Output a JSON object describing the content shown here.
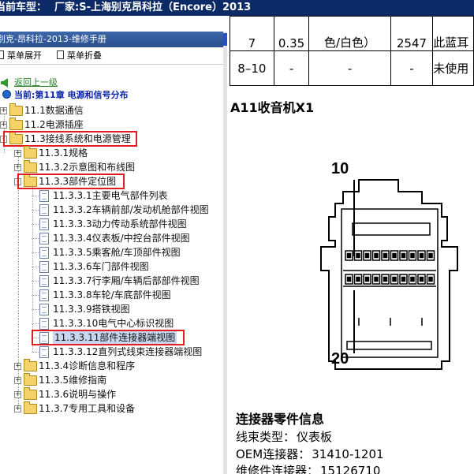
{
  "window": {
    "title_label": "当前车型：",
    "title_value": "厂家:S-上海别克昂科拉（Encore）2013"
  },
  "left_panel": {
    "title": "别克-昂科拉-2013-维修手册",
    "menu": {
      "expand": "菜单展开",
      "collapse": "菜单折叠"
    },
    "back_link": "返回上一级",
    "current": "当前:第11章 电源和信号分布",
    "tree": [
      {
        "label": "11.1数据通信",
        "kind": "folder",
        "level": 0,
        "expander": "+"
      },
      {
        "label": "11.2电源插座",
        "kind": "folder",
        "level": 0,
        "expander": "+"
      },
      {
        "label": "11.3接线系统和电源管理",
        "kind": "folder",
        "level": 0,
        "expander": "-",
        "highlighted": true
      },
      {
        "label": "11.3.1规格",
        "kind": "folder",
        "level": 1,
        "expander": "+"
      },
      {
        "label": "11.3.2示意图和布线图",
        "kind": "folder",
        "level": 1,
        "expander": "+"
      },
      {
        "label": "11.3.3部件定位图",
        "kind": "folder",
        "level": 1,
        "expander": "-",
        "highlighted": true
      },
      {
        "label": "11.3.3.1主要电气部件列表",
        "kind": "doc",
        "level": 2
      },
      {
        "label": "11.3.3.2车辆前部/发动机舱部件视图",
        "kind": "doc",
        "level": 2
      },
      {
        "label": "11.3.3.3动力传动系统部件视图",
        "kind": "doc",
        "level": 2
      },
      {
        "label": "11.3.3.4仪表板/中控台部件视图",
        "kind": "doc",
        "level": 2
      },
      {
        "label": "11.3.3.5乘客舱/车顶部件视图",
        "kind": "doc",
        "level": 2
      },
      {
        "label": "11.3.3.6车门部件视图",
        "kind": "doc",
        "level": 2
      },
      {
        "label": "11.3.3.7行李厢/车辆后部部件视图",
        "kind": "doc",
        "level": 2
      },
      {
        "label": "11.3.3.8车轮/车底部件视图",
        "kind": "doc",
        "level": 2
      },
      {
        "label": "11.3.3.9搭铁视图",
        "kind": "doc",
        "level": 2
      },
      {
        "label": "11.3.3.10电气中心标识视图",
        "kind": "doc",
        "level": 2
      },
      {
        "label": "11.3.3.11部件连接器端视图",
        "kind": "doc",
        "level": 2,
        "highlighted": true,
        "selected": true
      },
      {
        "label": "11.3.3.12直列式线束连接器端视图",
        "kind": "doc",
        "level": 2
      },
      {
        "label": "11.3.4诊断信息和程序",
        "kind": "folder",
        "level": 1,
        "expander": "+"
      },
      {
        "label": "11.3.5维修指南",
        "kind": "folder",
        "level": 1,
        "expander": "+"
      },
      {
        "label": "11.3.6说明与操作",
        "kind": "folder",
        "level": 1,
        "expander": "+"
      },
      {
        "label": "11.3.7专用工具和设备",
        "kind": "folder",
        "level": 1,
        "expander": "+"
      }
    ]
  },
  "content": {
    "pin_table": {
      "rows": [
        [
          "7",
          "0.35",
          "色/白色）",
          "2547",
          "此蓝耳"
        ],
        [
          "8–10",
          "-",
          "-",
          "-",
          "未使用"
        ]
      ]
    },
    "connector_title": "A11收音机X1",
    "pin_labels": {
      "top": "10",
      "bottom": "20"
    },
    "info_title": "连接器零件信息",
    "info": [
      {
        "key": "线束类型：",
        "value": "仪表板"
      },
      {
        "key": "OEM连接器：",
        "value": "31410-1201"
      },
      {
        "key": "维修件连接器：",
        "value": "15126710"
      }
    ]
  },
  "colors": {
    "title_bar": "#0b2a66",
    "panel_header": "#2f5a9b",
    "highlight_box": "#e31b23",
    "link": "#2a7f2a",
    "current": "#0a24a8"
  }
}
